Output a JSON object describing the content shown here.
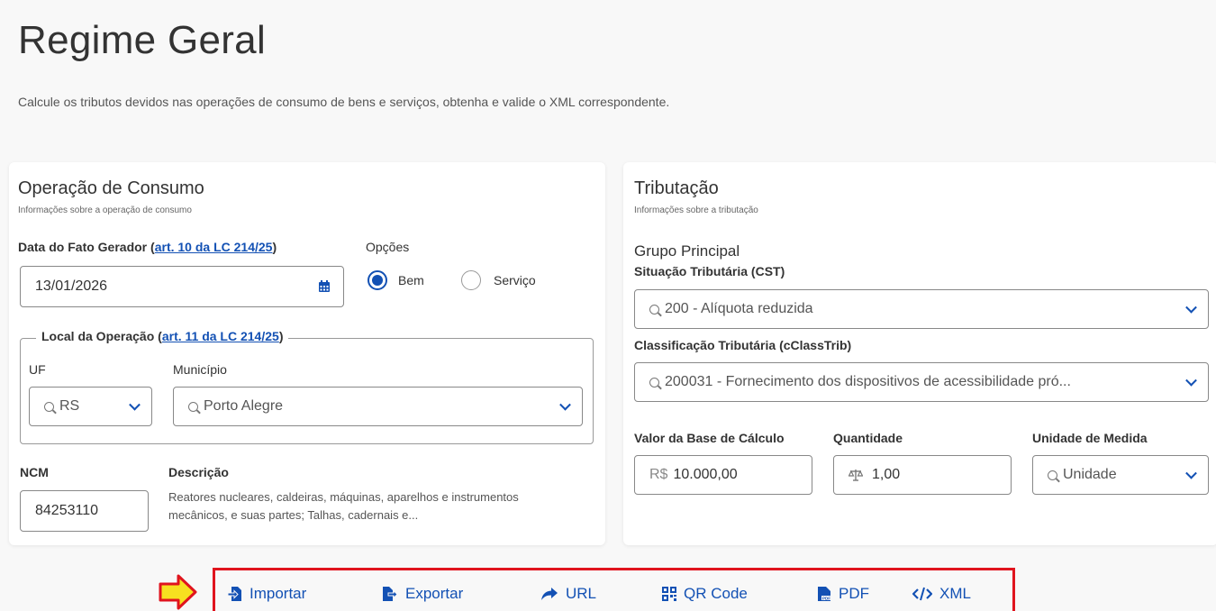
{
  "page": {
    "title": "Regime Geral",
    "subtitle": "Calcule os tributos devidos nas operações de consumo de bens e serviços, obtenha e valide o XML correspondente."
  },
  "operacao": {
    "title": "Operação de Consumo",
    "subtitle": "Informações sobre a operação de consumo",
    "data_label": "Data do Fato Gerador ",
    "data_link": "art. 10 da LC 214/25",
    "data_value": "13/01/2026",
    "opcoes_label": "Opções",
    "opcao_bem": "Bem",
    "opcao_servico": "Serviço",
    "local_label": "Local da Operação ",
    "local_link": "art. 11 da LC 214/25",
    "uf_label": "UF",
    "uf_value": "RS",
    "municipio_label": "Município",
    "municipio_value": "Porto Alegre",
    "ncm_label": "NCM",
    "ncm_value": "84253110",
    "descricao_label": "Descrição",
    "descricao_value": "Reatores nucleares, caldeiras, máquinas, aparelhos e instrumentos mecânicos, e suas partes; Talhas, cadernais e..."
  },
  "tributacao": {
    "title": "Tributação",
    "subtitle": "Informações sobre a tributação",
    "grupo": "Grupo Principal",
    "cst_label": "Situação Tributária (CST)",
    "cst_value": "200 - Alíquota reduzida",
    "cclass_label": "Classificação Tributária (cClassTrib)",
    "cclass_value": "200031 - Fornecimento dos dispositivos de acessibilidade pró...",
    "base_label": "Valor da Base de Cálculo",
    "base_prefix": "R$",
    "base_value": "10.000,00",
    "qtd_label": "Quantidade",
    "qtd_value": "1,00",
    "unidade_label": "Unidade de Medida",
    "unidade_value": "Unidade"
  },
  "toolbar": {
    "importar": "Importar",
    "exportar": "Exportar",
    "url": "URL",
    "qrcode": "QR Code",
    "pdf": "PDF",
    "xml": "XML"
  }
}
